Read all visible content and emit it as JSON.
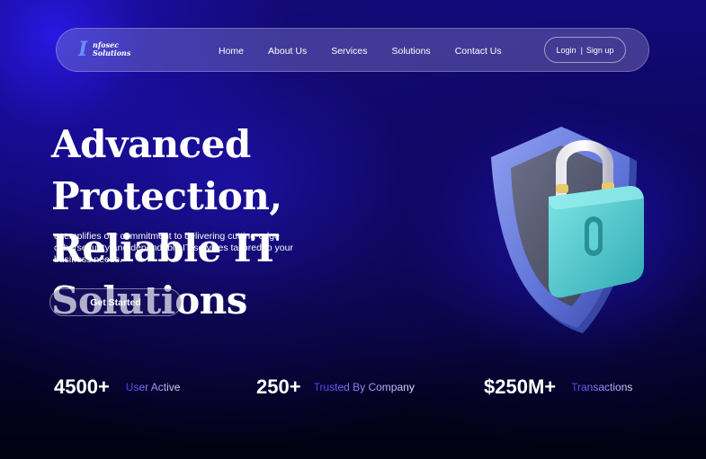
{
  "logo": {
    "mark": "I",
    "line1": "nfosec",
    "line2": "Solutions"
  },
  "nav": {
    "links": [
      "Home",
      "About Us",
      "Services",
      "Solutions",
      "Contact Us"
    ],
    "login_label": "Login",
    "separator": "|",
    "signup_label": "Sign up"
  },
  "hero": {
    "title_line1": "Advanced Protection,",
    "title_line2": "Reliable IT Solutions",
    "description": "exemplifies our commitment to delivering cutting-edge cybersecurity and dependable IT services tailored to your business needs.",
    "cta_label": "Get Started",
    "illustration_icon": "shield-padlock-icon"
  },
  "stats": [
    {
      "value": "4500+",
      "label": "User Active"
    },
    {
      "value": "250+",
      "label": "Trusted By Company"
    },
    {
      "value": "$250M+",
      "label": "Transactions"
    }
  ],
  "colors": {
    "background_top": "#120a7a",
    "background_bottom": "#02010f",
    "accent_blue": "#4d3cf5",
    "shield_blue": "#6f83e6",
    "padlock_teal": "#5fd3d6"
  }
}
